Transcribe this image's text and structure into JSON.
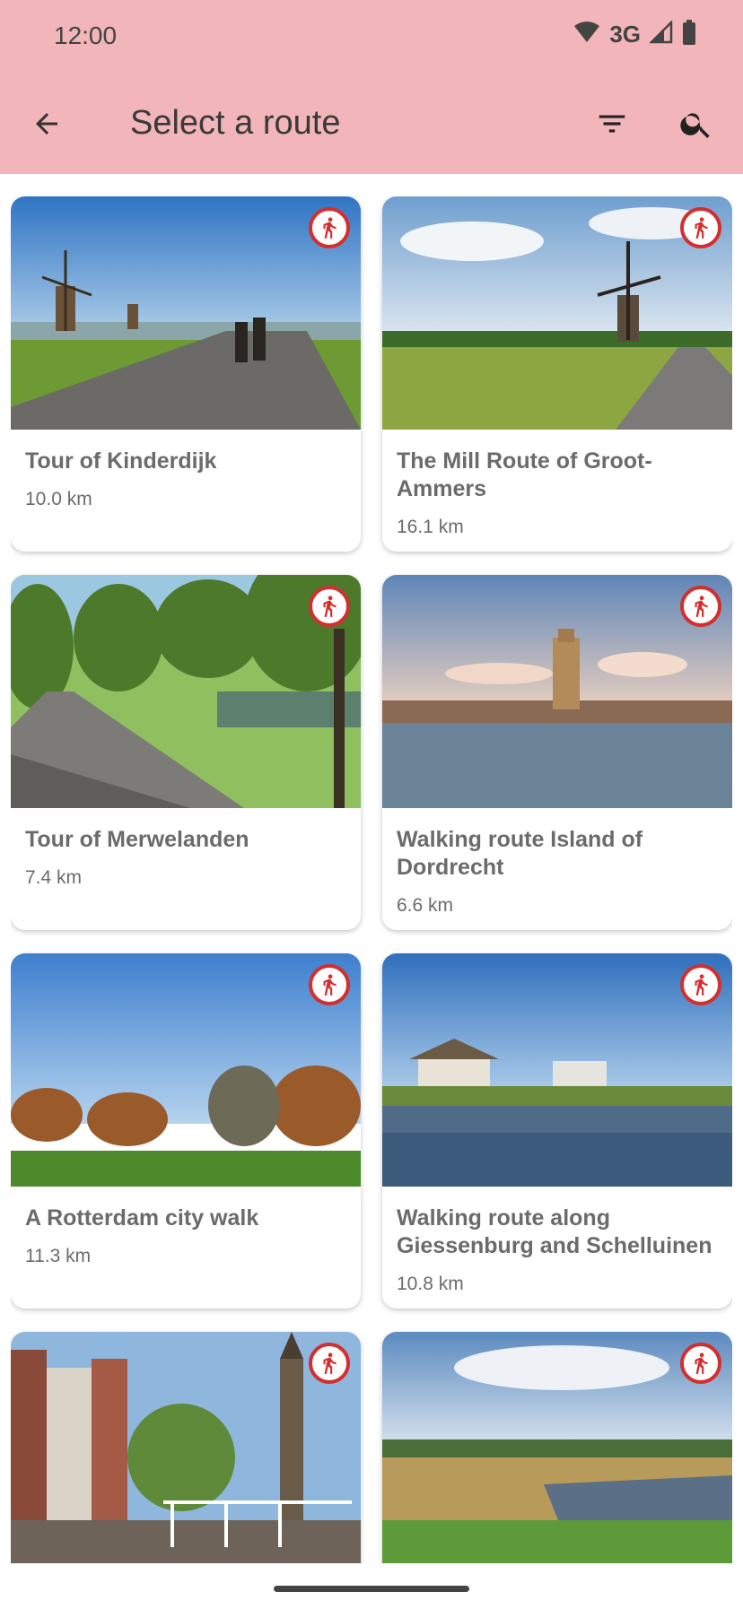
{
  "status": {
    "time": "12:00",
    "network": "3G"
  },
  "appbar": {
    "title": "Select a route",
    "back_icon": "arrow-back-icon",
    "filter_icon": "filter-icon",
    "search_icon": "search-icon",
    "color": "#f2b5b9"
  },
  "accent_color": "#d32f2f",
  "routes": [
    {
      "name": "Tour of Kinderdijk",
      "distance": "10.0 km",
      "icon": "walking-icon"
    },
    {
      "name": "The Mill Route of Groot-Ammers",
      "distance": "16.1 km",
      "icon": "walking-icon"
    },
    {
      "name": "Tour of Merwelanden",
      "distance": "7.4 km",
      "icon": "walking-icon"
    },
    {
      "name": "Walking route Island of Dordrecht",
      "distance": "6.6 km",
      "icon": "walking-icon"
    },
    {
      "name": "A Rotterdam city walk",
      "distance": "11.3 km",
      "icon": "walking-icon"
    },
    {
      "name": "Walking route along Giessenburg and Schelluinen",
      "distance": "10.8 km",
      "icon": "walking-icon"
    },
    {
      "name": "",
      "distance": "",
      "icon": "walking-icon"
    },
    {
      "name": "",
      "distance": "",
      "icon": "walking-icon"
    }
  ]
}
